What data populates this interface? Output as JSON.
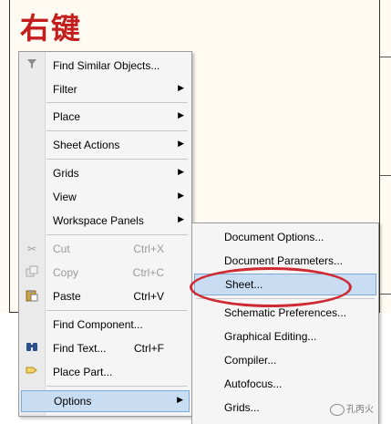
{
  "title": "右键",
  "main_menu": {
    "items": [
      {
        "label": "Find Similar Objects...",
        "icon": "funnel-icon",
        "arrow": false,
        "shortcut": "",
        "disabled": false
      },
      {
        "label": "Filter",
        "arrow": true,
        "shortcut": "",
        "disabled": false
      },
      {
        "label": "Place",
        "arrow": true,
        "shortcut": "",
        "disabled": false
      },
      {
        "label": "Sheet Actions",
        "arrow": true,
        "shortcut": "",
        "disabled": false
      },
      {
        "label": "Grids",
        "arrow": true,
        "shortcut": "",
        "disabled": false
      },
      {
        "label": "View",
        "arrow": true,
        "shortcut": "",
        "disabled": false
      },
      {
        "label": "Workspace Panels",
        "arrow": true,
        "shortcut": "",
        "disabled": false
      },
      {
        "label": "Cut",
        "icon": "scissors-icon",
        "shortcut": "Ctrl+X",
        "disabled": true
      },
      {
        "label": "Copy",
        "icon": "copy-icon",
        "shortcut": "Ctrl+C",
        "disabled": true
      },
      {
        "label": "Paste",
        "icon": "clipboard-icon",
        "shortcut": "Ctrl+V",
        "disabled": false
      },
      {
        "label": "Find Component...",
        "shortcut": "",
        "disabled": false
      },
      {
        "label": "Find Text...",
        "icon": "binoculars-icon",
        "shortcut": "Ctrl+F",
        "disabled": false
      },
      {
        "label": "Place Part...",
        "icon": "part-icon",
        "shortcut": "",
        "disabled": false
      },
      {
        "label": "Options",
        "arrow": true,
        "shortcut": "",
        "disabled": false,
        "highlighted": true
      }
    ]
  },
  "sub_menu": {
    "items": [
      {
        "label": "Document Options..."
      },
      {
        "label": "Document Parameters..."
      },
      {
        "label": "Sheet...",
        "highlighted": true
      },
      {
        "label": "Schematic Preferences..."
      },
      {
        "label": "Graphical Editing..."
      },
      {
        "label": "Compiler..."
      },
      {
        "label": "Autofocus..."
      },
      {
        "label": "Grids..."
      }
    ]
  },
  "watermark": "孔丙火",
  "colors": {
    "title_red": "#c41d1d",
    "highlight": "#c9ddf2",
    "annotation_red": "#cf2a33"
  }
}
